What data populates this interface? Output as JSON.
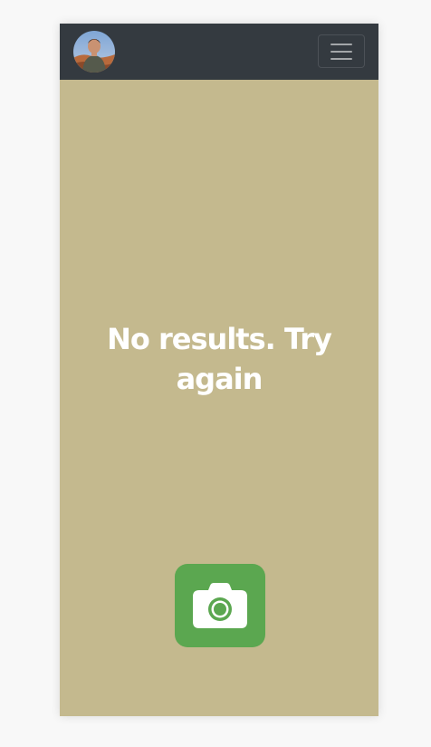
{
  "navbar": {
    "avatar_icon": "user-avatar",
    "menu_icon": "hamburger-menu-icon",
    "colors": {
      "background": "#343a40"
    }
  },
  "main": {
    "message": "No results. Try again",
    "camera_icon": "camera-icon",
    "colors": {
      "background": "#c4b98e",
      "text": "#ffffff",
      "button": "#5ba750"
    }
  }
}
